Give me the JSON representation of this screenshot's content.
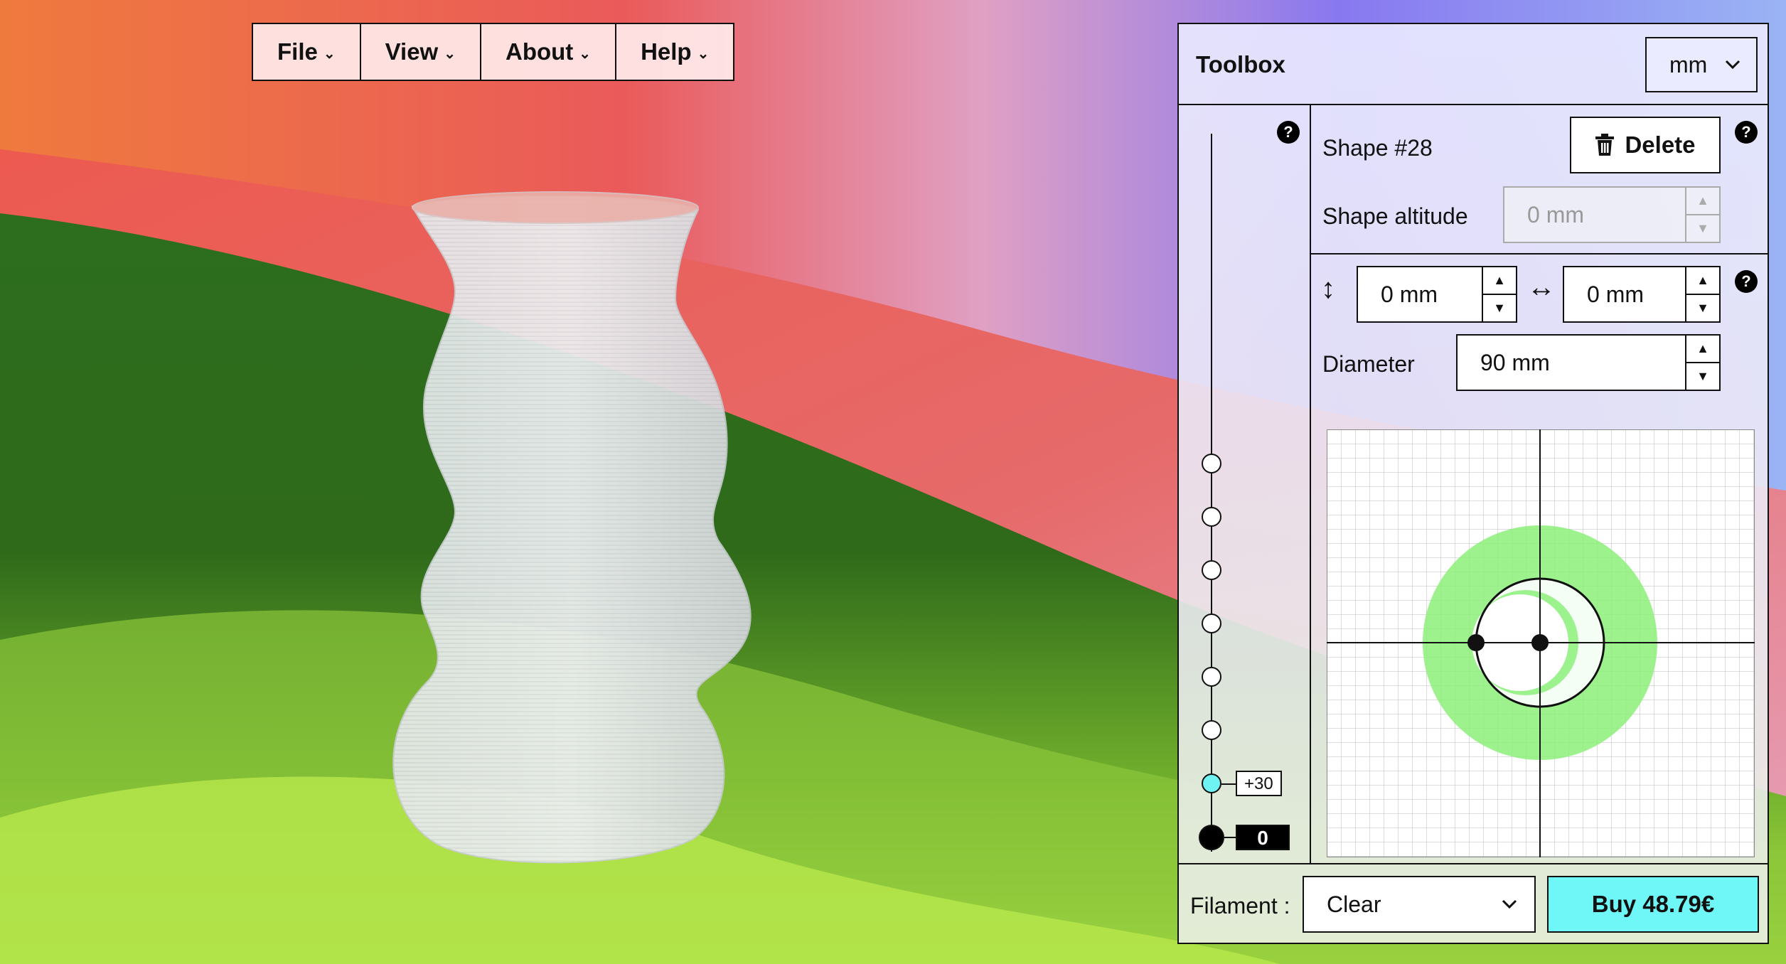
{
  "menu": [
    {
      "label": "File"
    },
    {
      "label": "View"
    },
    {
      "label": "About"
    },
    {
      "label": "Help"
    }
  ],
  "toolbox": {
    "title": "Toolbox",
    "unit": "mm",
    "help_glyph": "?",
    "shape": {
      "name": "Shape #28",
      "delete_label": "Delete",
      "altitude_label": "Shape altitude",
      "altitude_value": "0 mm"
    },
    "offset": {
      "vertical_value": "0 mm",
      "horizontal_value": "0 mm"
    },
    "diameter": {
      "label": "Diameter",
      "value": "90 mm"
    },
    "slider": {
      "selected_tag": "+30",
      "base_tag": "0"
    },
    "footer": {
      "filament_label": "Filament :",
      "filament_value": "Clear",
      "buy_label": "Buy 48.79€"
    }
  },
  "colors": {
    "accent_cyan": "#6ff7f7",
    "shape_green": "#8cf07a"
  },
  "icons": [
    "chevron-down-icon",
    "trash-icon",
    "help-icon",
    "vertical-arrow-icon",
    "horizontal-arrow-icon"
  ]
}
